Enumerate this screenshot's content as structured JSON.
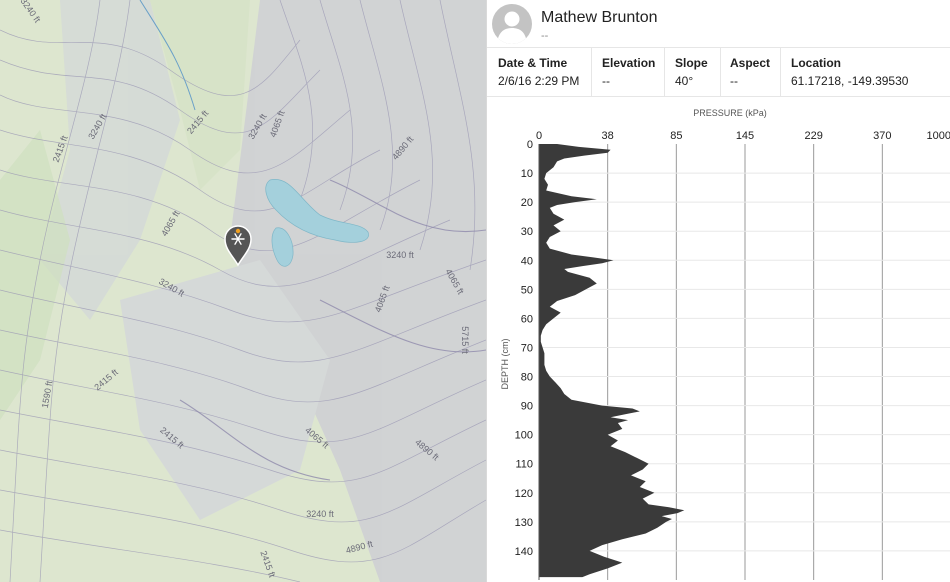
{
  "map": {
    "contour_labels": [
      "3240 ft",
      "2415 ft",
      "3240 ft",
      "2415 ft",
      "3240 ft",
      "4065 ft",
      "4890 ft",
      "4065 ft",
      "3240 ft",
      "4065 ft",
      "4065 ft",
      "5715 ft",
      "3240 ft",
      "2415 ft",
      "1590 ft",
      "2415 ft",
      "4065 ft",
      "4890 ft",
      "3240 ft",
      "4890 ft",
      "2415 ft"
    ],
    "marker_icon": "snowflake-pin-icon",
    "marker_color": "#555555",
    "marker_accent": "#f0a020"
  },
  "observation": {
    "user_name": "Mathew Brunton",
    "user_subtitle": "--",
    "avatar_icon": "user-avatar-icon",
    "meta": [
      {
        "label": "Date & Time",
        "value": "2/6/16 2:29 PM"
      },
      {
        "label": "Elevation",
        "value": "--"
      },
      {
        "label": "Slope",
        "value": "40°"
      },
      {
        "label": "Aspect",
        "value": "--"
      },
      {
        "label": "Location",
        "value": "61.17218, -149.39530"
      }
    ]
  },
  "chart_data": {
    "type": "area",
    "title": "",
    "xlabel": "PRESSURE (kPa)",
    "ylabel": "DEPTH (cm)",
    "x_ticks": [
      0,
      38,
      85,
      145,
      229,
      370,
      1000
    ],
    "y_ticks": [
      0,
      10,
      20,
      30,
      40,
      50,
      60,
      70,
      80,
      90,
      100,
      110,
      120,
      130,
      140
    ],
    "ylim": [
      0,
      150
    ],
    "x_scale": "log-like (non-linear, labeled ticks)",
    "grid": true,
    "fill_color": "#3a3a3a",
    "series": [
      {
        "depth": [
          0,
          1,
          2,
          3,
          4,
          5,
          6,
          8,
          10,
          12,
          14,
          16,
          18,
          19,
          20,
          21,
          22,
          24,
          26,
          28,
          30,
          32,
          34,
          36,
          38,
          39,
          40,
          41,
          42,
          43,
          44,
          46,
          48,
          50,
          52,
          54,
          56,
          58,
          60,
          62,
          64,
          66,
          68,
          70,
          72,
          74,
          76,
          78,
          80,
          82,
          84,
          86,
          88,
          90,
          91,
          92,
          93,
          94,
          95,
          96,
          98,
          100,
          102,
          104,
          106,
          108,
          110,
          112,
          114,
          116,
          118,
          120,
          122,
          124,
          125,
          126,
          127,
          128,
          129,
          130,
          132,
          134,
          136,
          138,
          140,
          142,
          144,
          146,
          148,
          149
        ],
        "pressure": [
          10,
          22,
          40,
          38,
          25,
          14,
          10,
          8,
          4,
          3,
          5,
          4,
          18,
          32,
          20,
          10,
          6,
          8,
          14,
          8,
          12,
          6,
          4,
          6,
          18,
          30,
          42,
          35,
          24,
          14,
          16,
          28,
          32,
          26,
          20,
          10,
          6,
          12,
          8,
          4,
          2,
          1,
          1,
          2,
          3,
          3,
          3,
          4,
          6,
          9,
          12,
          14,
          18,
          35,
          55,
          60,
          50,
          40,
          52,
          45,
          48,
          38,
          45,
          40,
          50,
          58,
          66,
          62,
          54,
          64,
          60,
          70,
          62,
          66,
          80,
          92,
          86,
          75,
          82,
          78,
          72,
          64,
          48,
          35,
          28,
          36,
          48,
          38,
          28,
          24
        ]
      }
    ]
  }
}
